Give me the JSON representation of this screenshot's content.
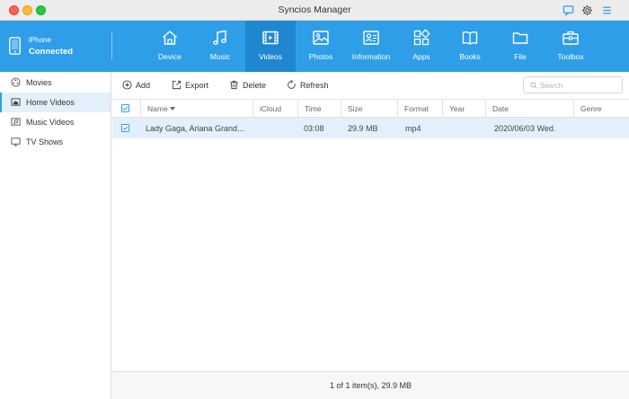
{
  "window": {
    "title": "Syncios Manager"
  },
  "device": {
    "name": "iPhone",
    "status": "Connected"
  },
  "nav": [
    {
      "label": "Device",
      "icon": "home-icon"
    },
    {
      "label": "Music",
      "icon": "music-note-icon"
    },
    {
      "label": "Videos",
      "icon": "film-icon",
      "active": true
    },
    {
      "label": "Photos",
      "icon": "image-icon"
    },
    {
      "label": "Information",
      "icon": "contact-card-icon"
    },
    {
      "label": "Apps",
      "icon": "apps-grid-icon"
    },
    {
      "label": "Books",
      "icon": "open-book-icon"
    },
    {
      "label": "File",
      "icon": "folder-icon"
    },
    {
      "label": "Toolbox",
      "icon": "toolbox-icon"
    }
  ],
  "sidebar": {
    "items": [
      {
        "label": "Movies",
        "icon": "movie-reel-icon"
      },
      {
        "label": "Home Videos",
        "icon": "home-video-icon",
        "active": true
      },
      {
        "label": "Music Videos",
        "icon": "music-video-icon"
      },
      {
        "label": "TV Shows",
        "icon": "tv-icon"
      }
    ]
  },
  "actions": {
    "add": "Add",
    "export": "Export",
    "delete": "Delete",
    "refresh": "Refresh",
    "search_placeholder": "Search"
  },
  "table": {
    "columns": {
      "name": "Name",
      "icloud": "iCloud",
      "time": "Time",
      "size": "Size",
      "format": "Format",
      "year": "Year",
      "date": "Date",
      "genre": "Genre"
    },
    "rows": [
      {
        "checked": true,
        "name": "Lady Gaga, Ariana Grand...",
        "icloud": "",
        "time": "03:08",
        "size": "29.9 MB",
        "format": "mp4",
        "year": "",
        "date": "2020/06/03 Wed.",
        "genre": ""
      }
    ]
  },
  "status": {
    "text": "1 of 1 item(s), 29.9 MB"
  },
  "colors": {
    "accent": "#2f9ee8",
    "accent_active": "#1f87d0",
    "selected_row": "#e3f0fb"
  }
}
